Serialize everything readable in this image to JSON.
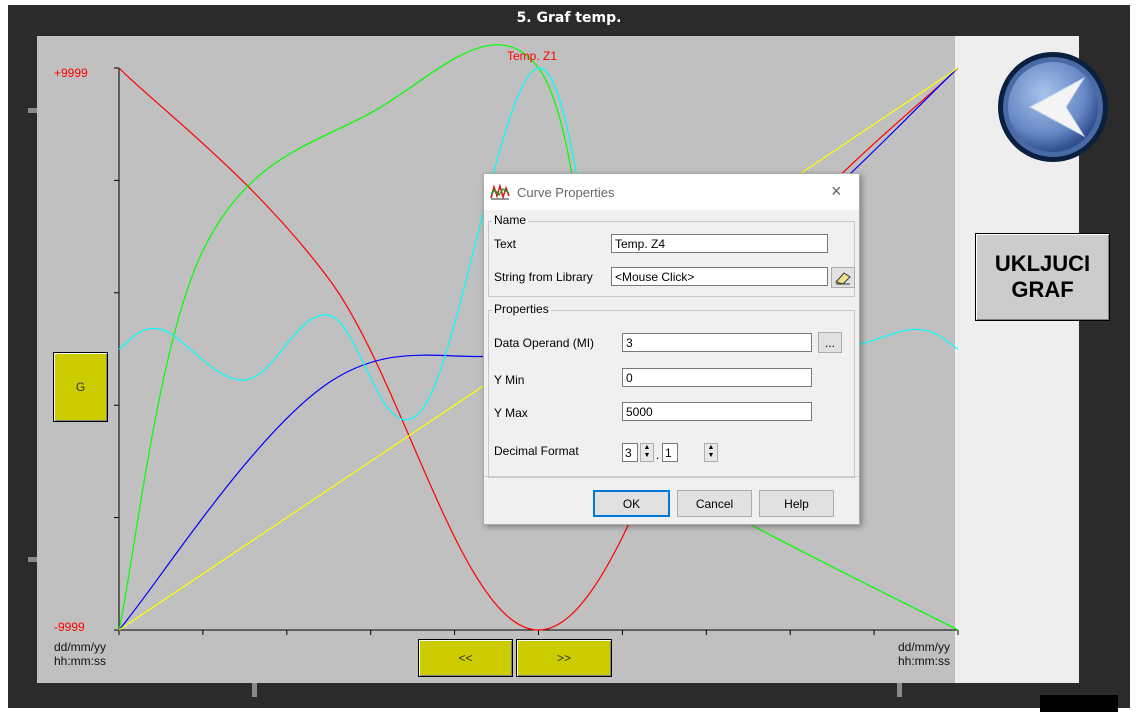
{
  "window": {
    "title": "5. Graf temp."
  },
  "chart": {
    "y_max_label": "+9999",
    "y_min_label": "-9999",
    "series_label": "Temp. Z1",
    "x_left_date": "dd/mm/yy",
    "x_left_time": "hh:mm:ss",
    "x_right_date": "dd/mm/yy",
    "x_right_time": "hh:mm:ss"
  },
  "chart_data": {
    "type": "line",
    "title": "",
    "ylim": [
      -9999,
      9999
    ],
    "yticks": [
      "+9999",
      "-9999"
    ],
    "xticks": [
      "dd/mm/yy hh:mm:ss",
      "dd/mm/yy hh:mm:ss"
    ],
    "grid": false,
    "annotations": [
      "Temp. Z1"
    ],
    "series": [
      {
        "color": "#ff0000",
        "x": [
          0,
          0.25,
          0.5,
          0.75,
          1
        ],
        "values": [
          9999,
          2500,
          -9999,
          2500,
          9999
        ]
      },
      {
        "color": "#00ff00",
        "x": [
          0,
          0.1,
          0.3,
          0.5,
          0.6,
          0.75,
          1
        ],
        "values": [
          -9999,
          3500,
          8400,
          9999,
          -3500,
          -6200,
          -9999
        ]
      },
      {
        "color": "#0000ff",
        "x": [
          0,
          0.25,
          0.5,
          0.75,
          1
        ],
        "values": [
          -9999,
          -1200,
          0,
          3200,
          9999
        ]
      },
      {
        "color": "#ffff00",
        "x": [
          0,
          1
        ],
        "values": [
          -9999,
          9999
        ]
      },
      {
        "color": "#00ffff",
        "x": [
          0,
          0.05,
          0.15,
          0.25,
          0.36,
          0.5,
          0.6,
          0.7,
          0.85,
          0.95,
          1
        ],
        "values": [
          0,
          700,
          -1100,
          1200,
          -2200,
          9999,
          -1500,
          200,
          0,
          700,
          0
        ]
      }
    ]
  },
  "buttons": {
    "g": "G",
    "prev": "<<",
    "next": ">>",
    "graf_line1": "UKLJUCI",
    "graf_line2": "GRAF"
  },
  "icons": {
    "back": "back-arrow-icon",
    "dialog": "curve-properties-icon",
    "eraser": "eraser-icon"
  },
  "dialog": {
    "title": "Curve Properties",
    "close": "×",
    "name_group": "Name",
    "text_label": "Text",
    "text_value": "Temp. Z4",
    "library_label": "String from Library",
    "library_value": "<Mouse Click>",
    "props_group": "Properties",
    "operand_label": "Data Operand (MI)",
    "operand_value": "3",
    "browse": "...",
    "ymin_label": "Y Min",
    "ymin_value": "0",
    "ymax_label": "Y Max",
    "ymax_value": "5000",
    "decimal_label": "Decimal Format",
    "decimal_int": "3",
    "decimal_sep": ".",
    "decimal_frac": "1",
    "ok": "OK",
    "cancel": "Cancel",
    "help": "Help"
  }
}
